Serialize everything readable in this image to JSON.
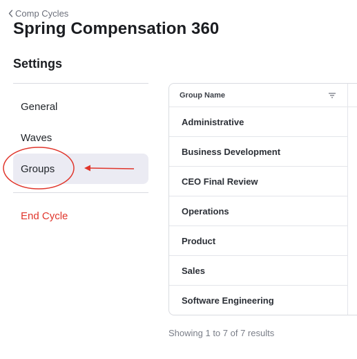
{
  "breadcrumb": {
    "label": "Comp Cycles",
    "icon": "chevron-left-icon"
  },
  "page": {
    "title": "Spring Compensation 360"
  },
  "settings": {
    "title": "Settings",
    "nav": [
      {
        "label": "General",
        "active": false
      },
      {
        "label": "Waves",
        "active": false
      },
      {
        "label": "Groups",
        "active": true
      }
    ],
    "end_cycle_label": "End Cycle"
  },
  "table": {
    "column_header": "Group Name",
    "filter_icon": "filter-icon",
    "rows": [
      "Administrative",
      "Business Development",
      "CEO Final Review",
      "Operations",
      "Product",
      "Sales",
      "Software Engineering"
    ],
    "footer": "Showing 1 to 7 of 7 results"
  },
  "colors": {
    "active_bg": "#ebebf3",
    "danger": "#e0352b",
    "annotation": "#e0352b",
    "border": "#d9dbe0"
  }
}
